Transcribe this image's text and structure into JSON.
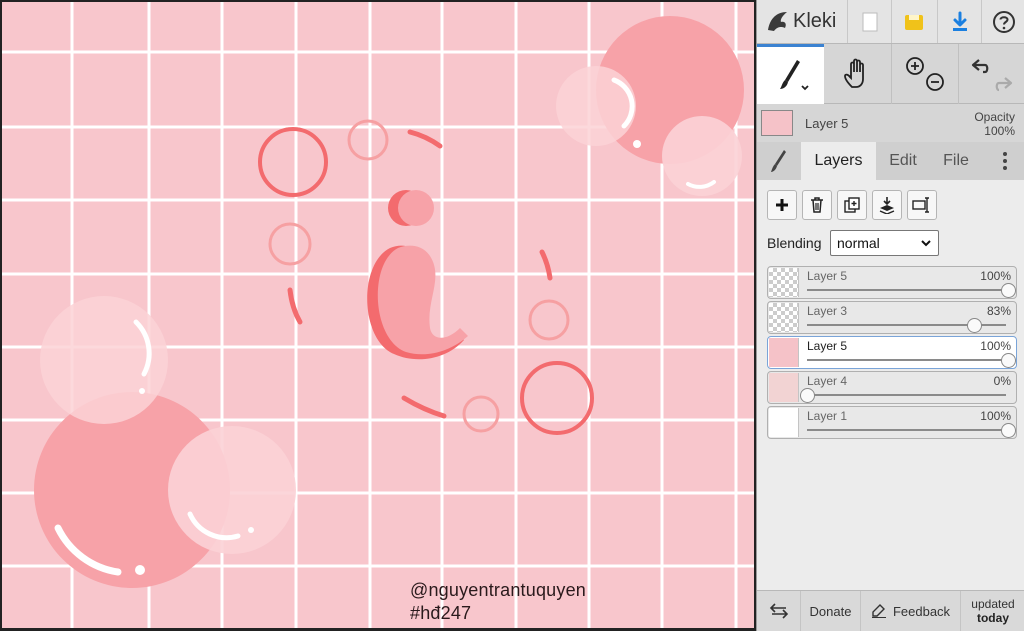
{
  "app": {
    "name": "Kleki"
  },
  "canvas": {
    "credit_user": "@nguyentrantuquyen",
    "credit_tag": "#hđ247",
    "background_color": "#f8c6cc",
    "grid_color": "#ffffff",
    "accent_color": "#f36b6e"
  },
  "current_layer": {
    "name": "Layer 5",
    "opacity_label": "Opacity",
    "opacity_value": "100%"
  },
  "tabs": {
    "layers": "Layers",
    "edit": "Edit",
    "file": "File"
  },
  "layers_panel": {
    "blending_label": "Blending",
    "blending_value": "normal",
    "layers": [
      {
        "name": "Layer 5",
        "opacity_text": "100%",
        "opacity": 1.0,
        "active": false
      },
      {
        "name": "Layer 3",
        "opacity_text": "83%",
        "opacity": 0.83,
        "active": false
      },
      {
        "name": "Layer 5",
        "opacity_text": "100%",
        "opacity": 1.0,
        "active": true
      },
      {
        "name": "Layer 4",
        "opacity_text": "0%",
        "opacity": 0.0,
        "active": false
      },
      {
        "name": "Layer 1",
        "opacity_text": "100%",
        "opacity": 1.0,
        "active": false
      }
    ]
  },
  "footer": {
    "donate": "Donate",
    "feedback": "Feedback",
    "updated_line1": "updated",
    "updated_line2": "today"
  },
  "colors": {
    "active_tool_accent": "#3b82d1",
    "save_icon": "#f0c21a",
    "download_icon": "#1a7fe0"
  },
  "icons": {
    "logo": "kleki-logo-icon",
    "new": "new-file-icon",
    "save": "save-icon",
    "download": "download-icon",
    "help": "help-icon",
    "brush": "brush-icon",
    "hand": "hand-icon",
    "zoom_in": "zoom-in-icon",
    "zoom_out": "zoom-out-icon",
    "undo": "undo-icon",
    "redo": "redo-icon",
    "add_layer": "add-layer-icon",
    "delete_layer": "delete-layer-icon",
    "duplicate_layer": "duplicate-layer-icon",
    "merge_layer": "merge-down-icon",
    "rename_layer": "rename-layer-icon",
    "swap": "swap-sides-icon",
    "feedback": "feedback-icon"
  }
}
